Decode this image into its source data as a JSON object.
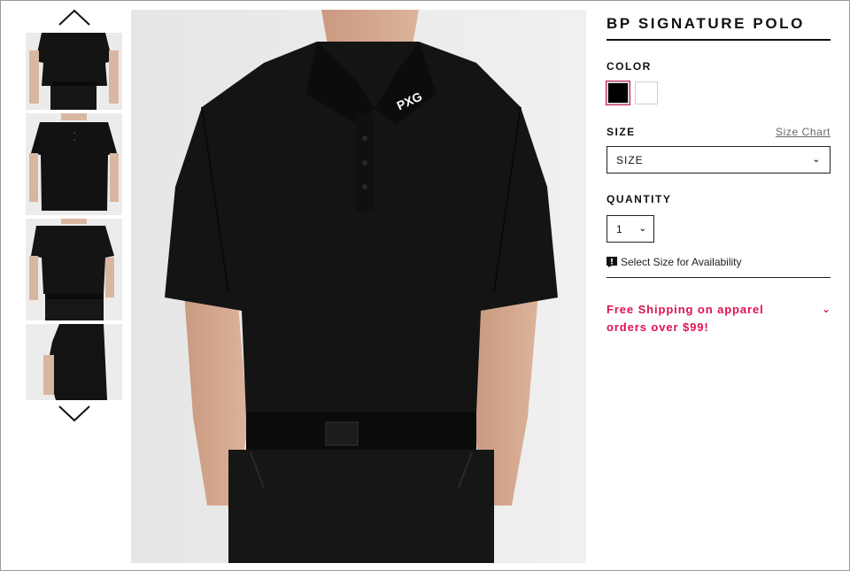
{
  "product": {
    "title": "BP SIGNATURE POLO",
    "logo_text": "PXG"
  },
  "color": {
    "label": "COLOR",
    "swatches": [
      {
        "name": "black",
        "hex": "#000000",
        "selected": true
      },
      {
        "name": "white",
        "hex": "#ffffff",
        "selected": false
      }
    ]
  },
  "size": {
    "label": "SIZE",
    "chart_link": "Size Chart",
    "select_value": "SIZE"
  },
  "quantity": {
    "label": "QUANTITY",
    "value": "1"
  },
  "availability": {
    "text": "Select Size for Availability",
    "icon": "alert-icon"
  },
  "shipping": {
    "text": "Free Shipping on apparel orders over $99!",
    "accent": "#e0114f"
  },
  "gallery": {
    "thumbnails": [
      "front-view",
      "front-close",
      "front-pocket",
      "side-view"
    ],
    "icons": [
      "chevron-up-icon",
      "chevron-down-icon"
    ]
  }
}
